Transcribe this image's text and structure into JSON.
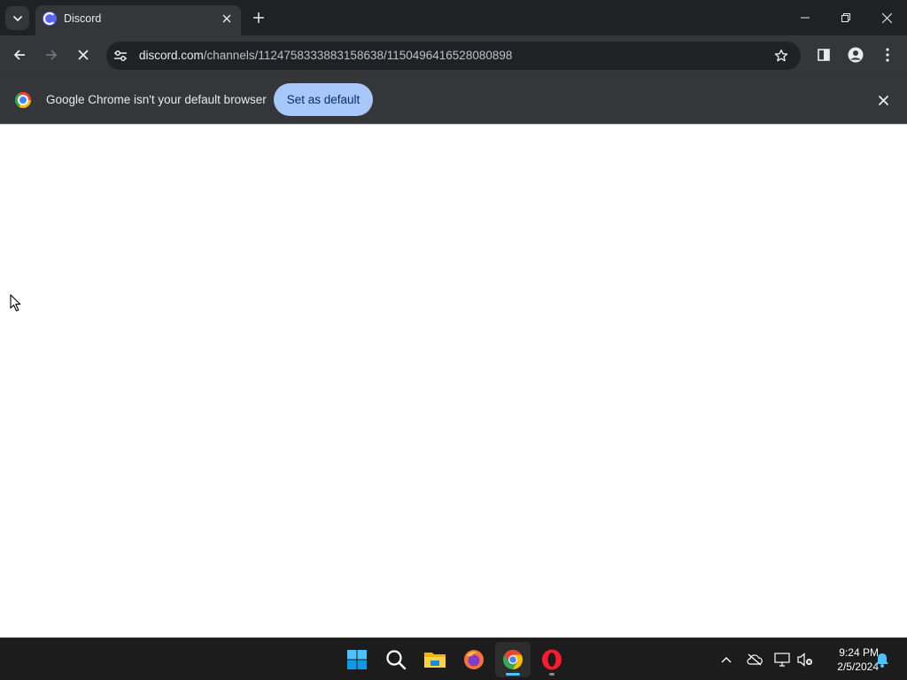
{
  "browser": {
    "tab": {
      "title": "Discord",
      "favicon": "discord-icon"
    },
    "url": {
      "host": "discord.com",
      "path": "/channels/1124758333883158638/1150496416528080898"
    },
    "loading": true
  },
  "infobar": {
    "message": "Google Chrome isn't your default browser",
    "button_label": "Set as default"
  },
  "taskbar": {
    "apps": [
      "start-icon",
      "search-icon",
      "file-explorer-icon",
      "firefox-icon",
      "chrome-icon",
      "opera-icon"
    ],
    "active_app": "chrome-icon"
  },
  "clock": {
    "time": "9:24 PM",
    "date": "2/5/2024"
  },
  "colors": {
    "accent_button": "#a8c7fa",
    "chrome_frame": "#202124",
    "toolbar": "#35363a",
    "taskbar": "#1c1c1c",
    "discord": "#5865f2"
  }
}
